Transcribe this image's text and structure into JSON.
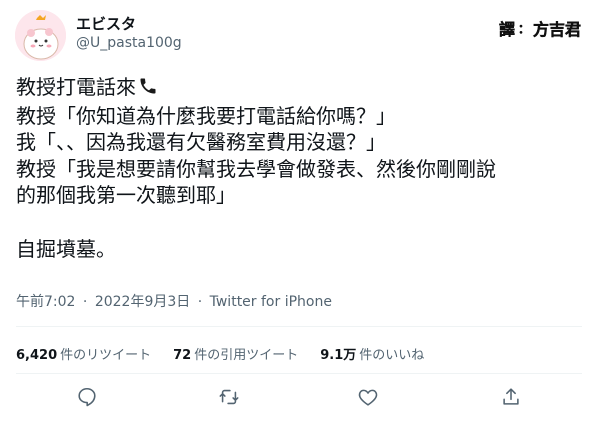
{
  "account": {
    "display_name": "エビスタ",
    "handle": "@U_pasta100g"
  },
  "credit": {
    "prefix": "譯",
    "separator": "：",
    "name": "方吉君"
  },
  "tweet": {
    "lines": [
      "教授打電話來",
      "教授「你知道為什麼我要打電話給你嗎？」",
      "我「、、因為我還有欠醫務室費用沒還？」",
      "教授「我是想要請你幫我去學會做發表、然後你剛剛說",
      "的那個我第一次聽到耶」",
      "自掘墳墓。"
    ]
  },
  "meta": {
    "time": "午前7:02",
    "dot": "·",
    "date": "2022年9月3日",
    "source": "Twitter for iPhone"
  },
  "stats": {
    "retweets_count": "6,420",
    "retweets_label": "件のリツイート",
    "quotes_count": "72",
    "quotes_label": "件の引用ツイート",
    "likes_count": "9.1万",
    "likes_label": "件のいいね"
  },
  "icons": {
    "phone": "telephone-receiver",
    "reply": "reply-icon",
    "retweet": "retweet-icon",
    "like": "heart-icon",
    "share": "share-icon"
  },
  "colors": {
    "text": "#0f1419",
    "secondary": "#536471",
    "divider": "#eff3f4",
    "avatar_bg": "#fde6ec"
  }
}
